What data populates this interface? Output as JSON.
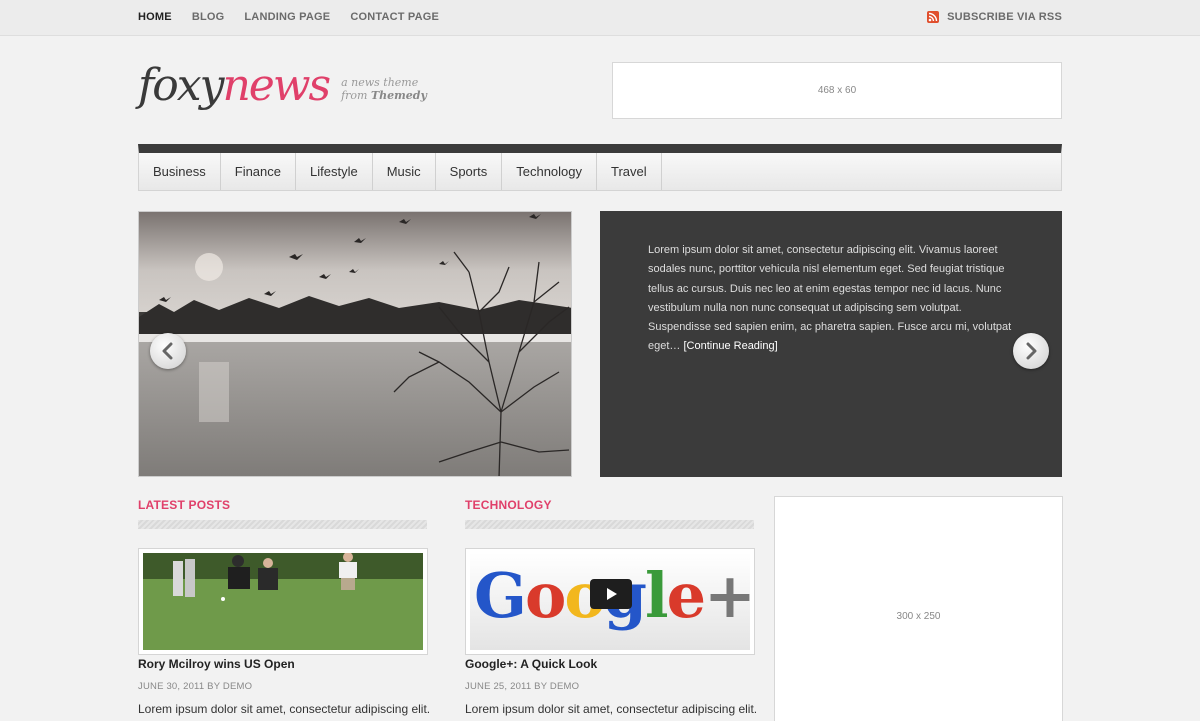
{
  "topnav": {
    "items": [
      {
        "label": "HOME"
      },
      {
        "label": "BLOG"
      },
      {
        "label": "LANDING PAGE"
      },
      {
        "label": "CONTACT PAGE"
      }
    ],
    "rss_label": "SUBSCRIBE VIA RSS"
  },
  "logo": {
    "part1": "foxy",
    "part2": "news",
    "tag_line1": "a news theme",
    "tag_line2_prefix": "from",
    "tag_line2_brand": "Themedy"
  },
  "header_ad": {
    "label": "468 x 60"
  },
  "categories": [
    {
      "label": "Business"
    },
    {
      "label": "Finance"
    },
    {
      "label": "Lifestyle"
    },
    {
      "label": "Music"
    },
    {
      "label": "Sports"
    },
    {
      "label": "Technology"
    },
    {
      "label": "Travel"
    }
  ],
  "slider": {
    "text": "Lorem ipsum dolor sit amet, consectetur adipiscing elit. Vivamus laoreet sodales nunc, porttitor vehicula nisl elementum eget. Sed feugiat tristique tellus ac cursus. Duis nec leo at enim egestas tempor nec id lacus. Nunc vestibulum nulla non nunc consequat ut adipiscing sem volutpat. Suspendisse sed sapien enim, ac pharetra sapien. Fusce arcu mi, volutpat eget…",
    "link": "[Continue Reading]"
  },
  "latest": {
    "heading": "LATEST POSTS",
    "post": {
      "title": "Rory Mcilroy wins US Open",
      "meta": "JUNE 30, 2011 BY DEMO",
      "excerpt": "Lorem ipsum dolor sit amet, consectetur adipiscing elit."
    }
  },
  "technology": {
    "heading": "TECHNOLOGY",
    "thumb_text": "Google+",
    "post": {
      "title": "Google+: A Quick Look",
      "meta": "JUNE 25, 2011 BY DEMO",
      "excerpt": "Lorem ipsum dolor sit amet, consectetur adipiscing elit."
    }
  },
  "sidebar_ad": {
    "label": "300 x 250"
  },
  "colors": {
    "accent": "#e0406a",
    "dark": "#3b3b3b",
    "rss": "#e04e2c"
  }
}
